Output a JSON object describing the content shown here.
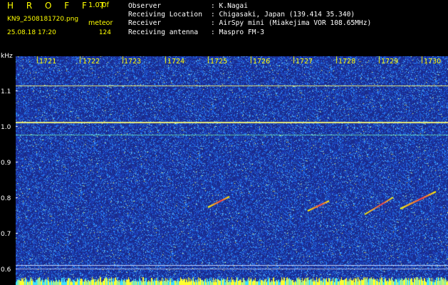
{
  "header": {
    "app_name": "H R O F F T",
    "version": "1.0.0f",
    "filename": "KN9_2508181720.png",
    "mode": "meteor",
    "datetime": "25.08.18 17:20",
    "count": "124"
  },
  "info": [
    {
      "label": "Observer",
      "value": ": K.Nagai"
    },
    {
      "label": "Receiving Location",
      "value": ": Chigasaki, Japan (139.414 35.340)"
    },
    {
      "label": "Receiver",
      "value": ": AirSpy mini (Miakejima VOR 108.65MHz)"
    },
    {
      "label": "Receiving antenna",
      "value": ": Maspro FM-3"
    }
  ],
  "plot": {
    "y_unit": "kHz",
    "x_ticks": [
      "1721",
      "1722",
      "1723",
      "1724",
      "1725",
      "1726",
      "1727",
      "1728",
      "1729",
      "1730"
    ],
    "y_ticks": [
      "1.1",
      "1.0",
      "0.9",
      "0.8",
      "0.7",
      "0.6"
    ],
    "colors": {
      "background": "#1a2b8c",
      "noise": "#3aa8ff",
      "signal": "#ffff00",
      "echo": "#ff4040"
    }
  }
}
